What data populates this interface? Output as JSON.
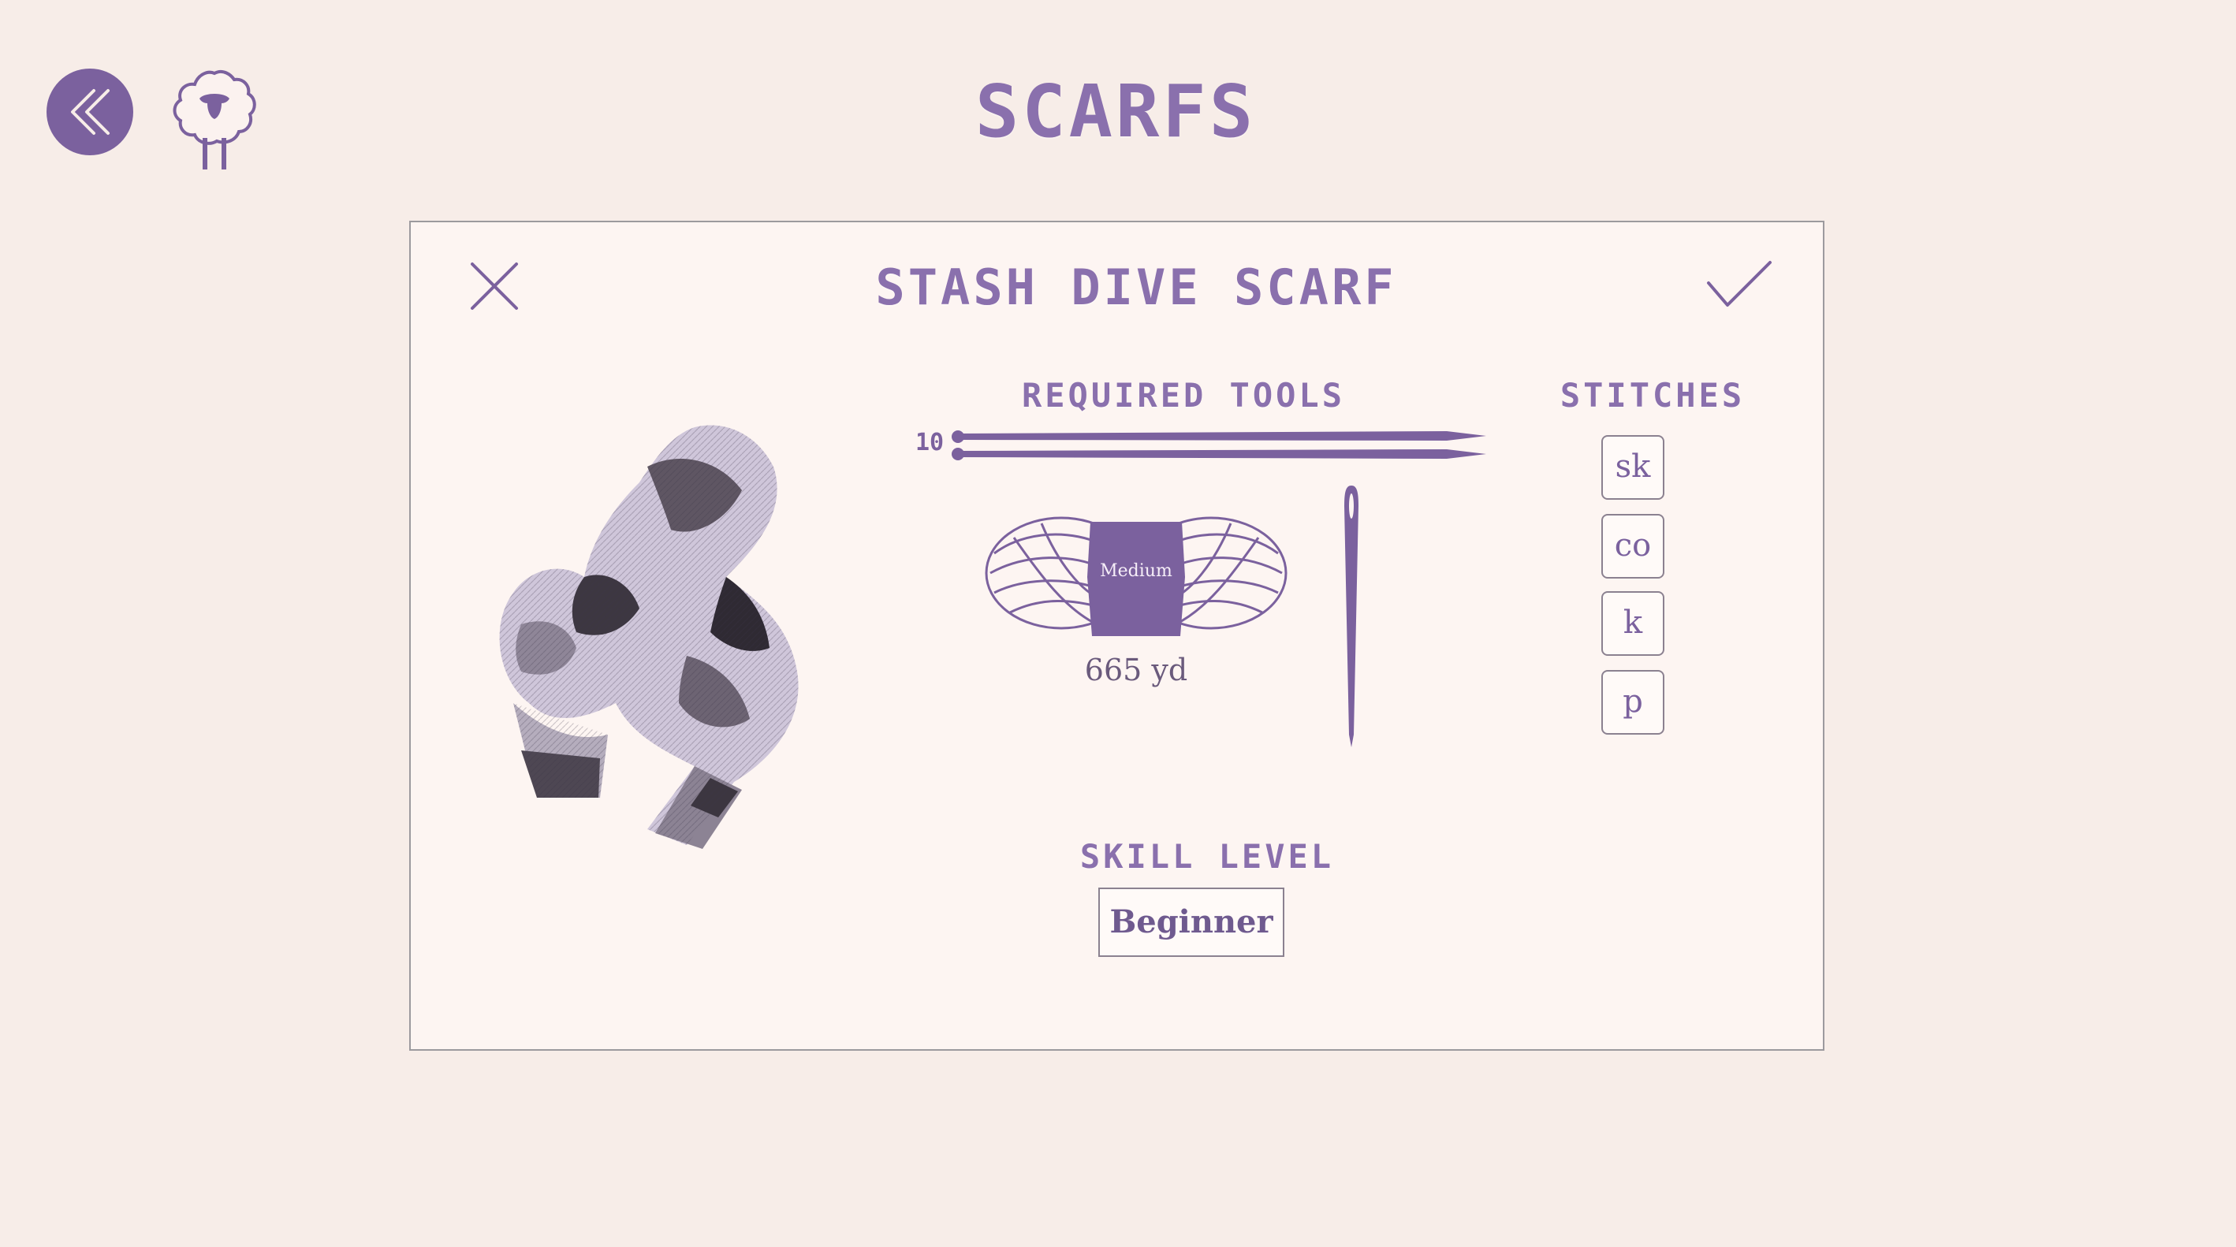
{
  "header": {
    "title": "SCARFS",
    "back_icon": "double-chevron-left-icon",
    "home_icon": "sheep-icon"
  },
  "pattern_card": {
    "title": "STASH DIVE SCARF",
    "close_icon": "close-icon",
    "confirm_icon": "checkmark-icon",
    "image": "striped-knit-scarf",
    "tools": {
      "heading": "REQUIRED TOOLS",
      "needle_size": "10",
      "yarn_weight": "Medium",
      "yarn_amount": "665 yd"
    },
    "stitches": {
      "heading": "STITCHES",
      "items": [
        "sk",
        "co",
        "k",
        "p"
      ]
    },
    "skill": {
      "heading": "SKILL LEVEL",
      "value": "Beginner"
    }
  },
  "colors": {
    "accent": "#7b619e",
    "background": "#f7ede8",
    "card": "#fdf5f2"
  }
}
